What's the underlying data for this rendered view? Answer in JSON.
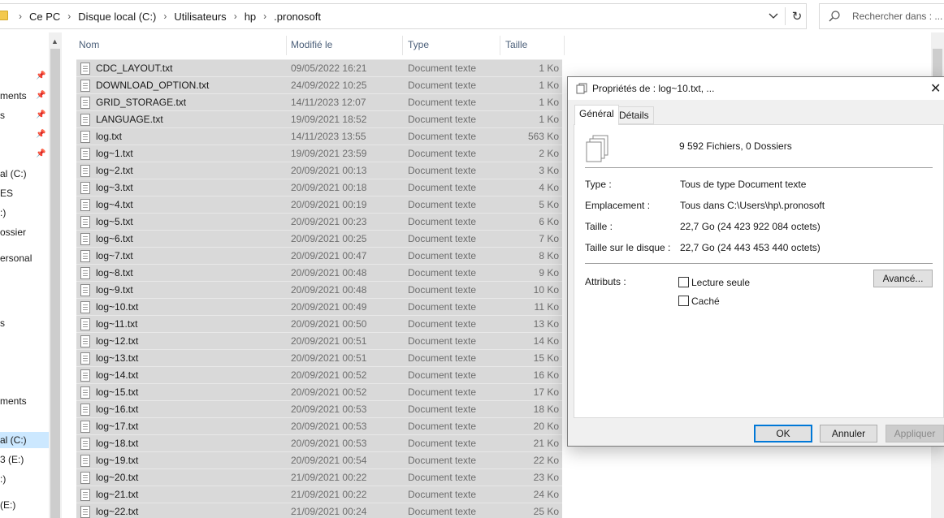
{
  "breadcrumb": [
    "Ce PC",
    "Disque local (C:)",
    "Utilisateurs",
    "hp",
    ".pronosoft"
  ],
  "search": {
    "placeholder": "Rechercher dans : ..."
  },
  "nav": {
    "items": [
      {
        "label": "ments",
        "pinned": true
      },
      {
        "label": "s",
        "pinned": true
      },
      {
        "label": "",
        "pinned": true
      },
      {
        "label": "",
        "pinned": true
      },
      {
        "label": "al (C:)",
        "pinned": false
      },
      {
        "label": "ES",
        "pinned": false
      },
      {
        "label": ":)",
        "pinned": false
      },
      {
        "label": "ossier",
        "pinned": false
      },
      {
        "label": "ersonal",
        "pinned": false
      },
      {
        "label": "s",
        "pinned": false
      },
      {
        "label": "ments",
        "pinned": false
      },
      {
        "label": "al (C:)",
        "pinned": false,
        "selected": true
      },
      {
        "label": "3 (E:)",
        "pinned": false
      },
      {
        "label": ":)",
        "pinned": false
      },
      {
        "label": "(E:)",
        "pinned": false
      }
    ]
  },
  "columns": {
    "name": "Nom",
    "modified": "Modifié le",
    "type": "Type",
    "size": "Taille"
  },
  "files": [
    {
      "name": "CDC_LAYOUT.txt",
      "modified": "09/05/2022 16:21",
      "type": "Document texte",
      "size": "1 Ko"
    },
    {
      "name": "DOWNLOAD_OPTION.txt",
      "modified": "24/09/2022 10:25",
      "type": "Document texte",
      "size": "1 Ko"
    },
    {
      "name": "GRID_STORAGE.txt",
      "modified": "14/11/2023 12:07",
      "type": "Document texte",
      "size": "1 Ko"
    },
    {
      "name": "LANGUAGE.txt",
      "modified": "19/09/2021 18:52",
      "type": "Document texte",
      "size": "1 Ko"
    },
    {
      "name": "log.txt",
      "modified": "14/11/2023 13:55",
      "type": "Document texte",
      "size": "563 Ko"
    },
    {
      "name": "log~1.txt",
      "modified": "19/09/2021 23:59",
      "type": "Document texte",
      "size": "2 Ko"
    },
    {
      "name": "log~2.txt",
      "modified": "20/09/2021 00:13",
      "type": "Document texte",
      "size": "3 Ko"
    },
    {
      "name": "log~3.txt",
      "modified": "20/09/2021 00:18",
      "type": "Document texte",
      "size": "4 Ko"
    },
    {
      "name": "log~4.txt",
      "modified": "20/09/2021 00:19",
      "type": "Document texte",
      "size": "5 Ko"
    },
    {
      "name": "log~5.txt",
      "modified": "20/09/2021 00:23",
      "type": "Document texte",
      "size": "6 Ko"
    },
    {
      "name": "log~6.txt",
      "modified": "20/09/2021 00:25",
      "type": "Document texte",
      "size": "7 Ko"
    },
    {
      "name": "log~7.txt",
      "modified": "20/09/2021 00:47",
      "type": "Document texte",
      "size": "8 Ko"
    },
    {
      "name": "log~8.txt",
      "modified": "20/09/2021 00:48",
      "type": "Document texte",
      "size": "9 Ko"
    },
    {
      "name": "log~9.txt",
      "modified": "20/09/2021 00:48",
      "type": "Document texte",
      "size": "10 Ko"
    },
    {
      "name": "log~10.txt",
      "modified": "20/09/2021 00:49",
      "type": "Document texte",
      "size": "11 Ko"
    },
    {
      "name": "log~11.txt",
      "modified": "20/09/2021 00:50",
      "type": "Document texte",
      "size": "13 Ko"
    },
    {
      "name": "log~12.txt",
      "modified": "20/09/2021 00:51",
      "type": "Document texte",
      "size": "14 Ko"
    },
    {
      "name": "log~13.txt",
      "modified": "20/09/2021 00:51",
      "type": "Document texte",
      "size": "15 Ko"
    },
    {
      "name": "log~14.txt",
      "modified": "20/09/2021 00:52",
      "type": "Document texte",
      "size": "16 Ko"
    },
    {
      "name": "log~15.txt",
      "modified": "20/09/2021 00:52",
      "type": "Document texte",
      "size": "17 Ko"
    },
    {
      "name": "log~16.txt",
      "modified": "20/09/2021 00:53",
      "type": "Document texte",
      "size": "18 Ko"
    },
    {
      "name": "log~17.txt",
      "modified": "20/09/2021 00:53",
      "type": "Document texte",
      "size": "20 Ko"
    },
    {
      "name": "log~18.txt",
      "modified": "20/09/2021 00:53",
      "type": "Document texte",
      "size": "21 Ko"
    },
    {
      "name": "log~19.txt",
      "modified": "20/09/2021 00:54",
      "type": "Document texte",
      "size": "22 Ko"
    },
    {
      "name": "log~20.txt",
      "modified": "21/09/2021 00:22",
      "type": "Document texte",
      "size": "23 Ko"
    },
    {
      "name": "log~21.txt",
      "modified": "21/09/2021 00:22",
      "type": "Document texte",
      "size": "24 Ko"
    },
    {
      "name": "log~22.txt",
      "modified": "21/09/2021 00:24",
      "type": "Document texte",
      "size": "25 Ko"
    }
  ],
  "dialog": {
    "title": "Propriétés de : log~10.txt, ...",
    "tabs": [
      "Général",
      "Détails"
    ],
    "count": "9 592 Fichiers, 0 Dossiers",
    "props": [
      {
        "label": "Type :",
        "value": "Tous de type Document texte"
      },
      {
        "label": "Emplacement :",
        "value": "Tous dans C:\\Users\\hp\\.pronosoft"
      },
      {
        "label": "Taille :",
        "value": "22,7 Go (24 423 922 084 octets)"
      },
      {
        "label": "Taille sur le disque :",
        "value": "22,7 Go (24 443 453 440 octets)"
      }
    ],
    "attributes_label": "Attributs :",
    "readonly_label": "Lecture seule",
    "hidden_label": "Caché",
    "advanced_button": "Avancé...",
    "ok_button": "OK",
    "cancel_button": "Annuler",
    "apply_button": "Appliquer"
  },
  "colors": {
    "selection_row": "#d9d9d9",
    "nav_selected": "#cce8ff",
    "primary_border": "#0078d7"
  }
}
